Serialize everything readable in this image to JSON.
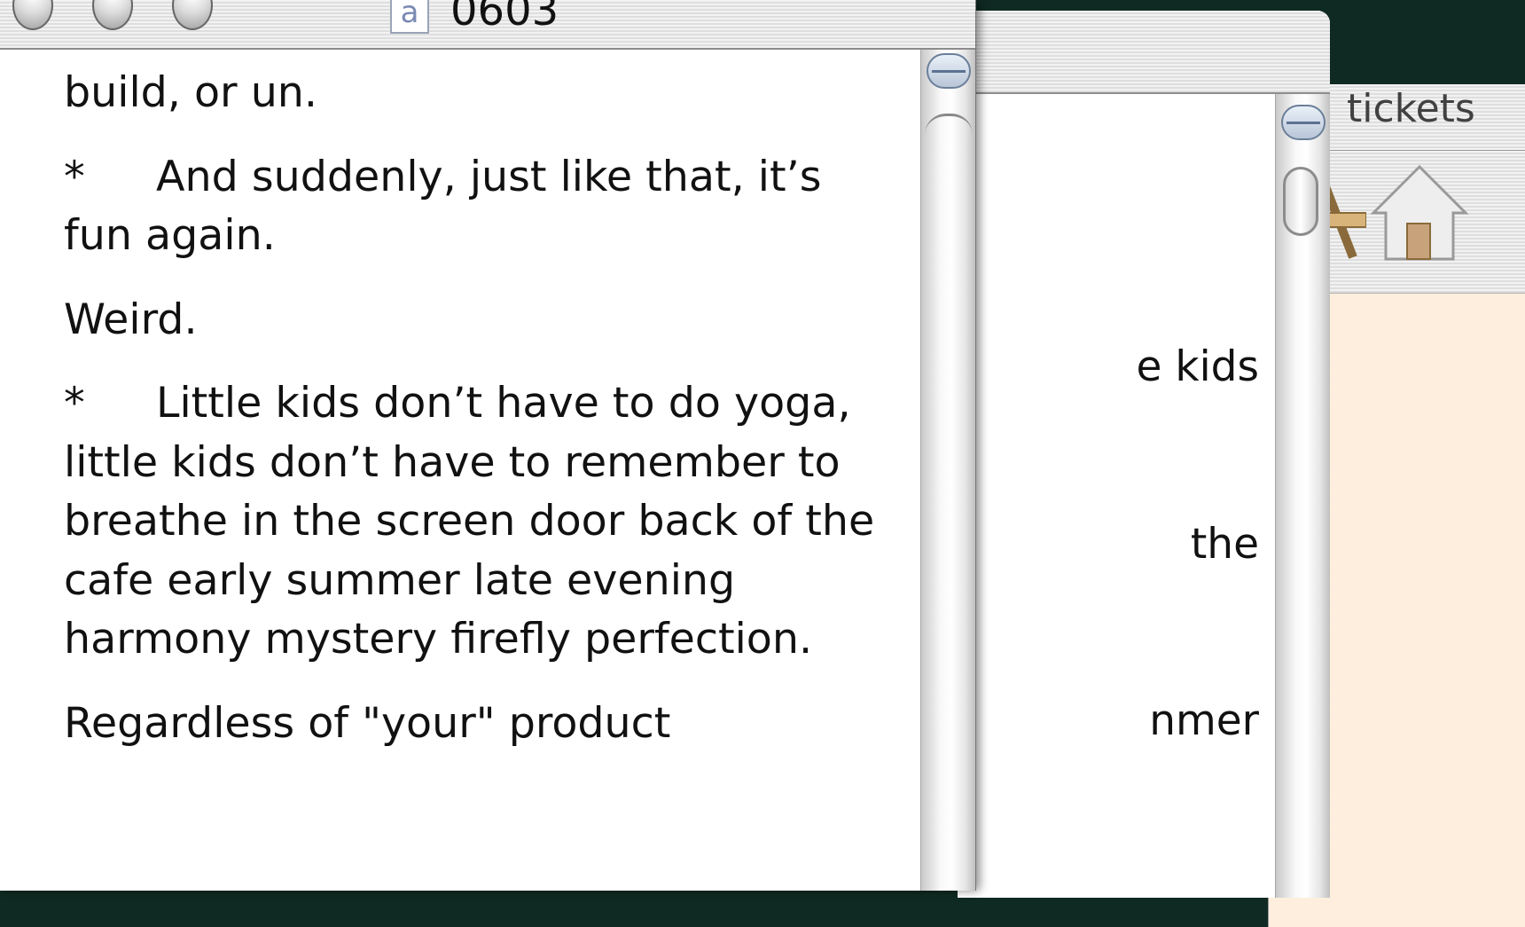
{
  "windows": {
    "front": {
      "title": "0603",
      "doc_icon_letter": "a",
      "paragraphs": [
        {
          "bullet": "",
          "text": "build, or un."
        },
        {
          "bullet": "*",
          "text": "And suddenly, just like that, it’s fun again."
        },
        {
          "bullet": "",
          "text": "Weird."
        },
        {
          "bullet": "*",
          "text": "Little kids don’t have to do yoga, little kids don’t have to remember to breathe in the screen door back of the cafe early summer late evening harmony mystery firefly perfection."
        },
        {
          "bullet": "",
          "text": "Regardless of \"your\" product"
        }
      ]
    },
    "middle": {
      "visible_lines": [
        "e kids",
        "the",
        "nmer"
      ]
    },
    "back": {
      "title": "tickets"
    }
  }
}
